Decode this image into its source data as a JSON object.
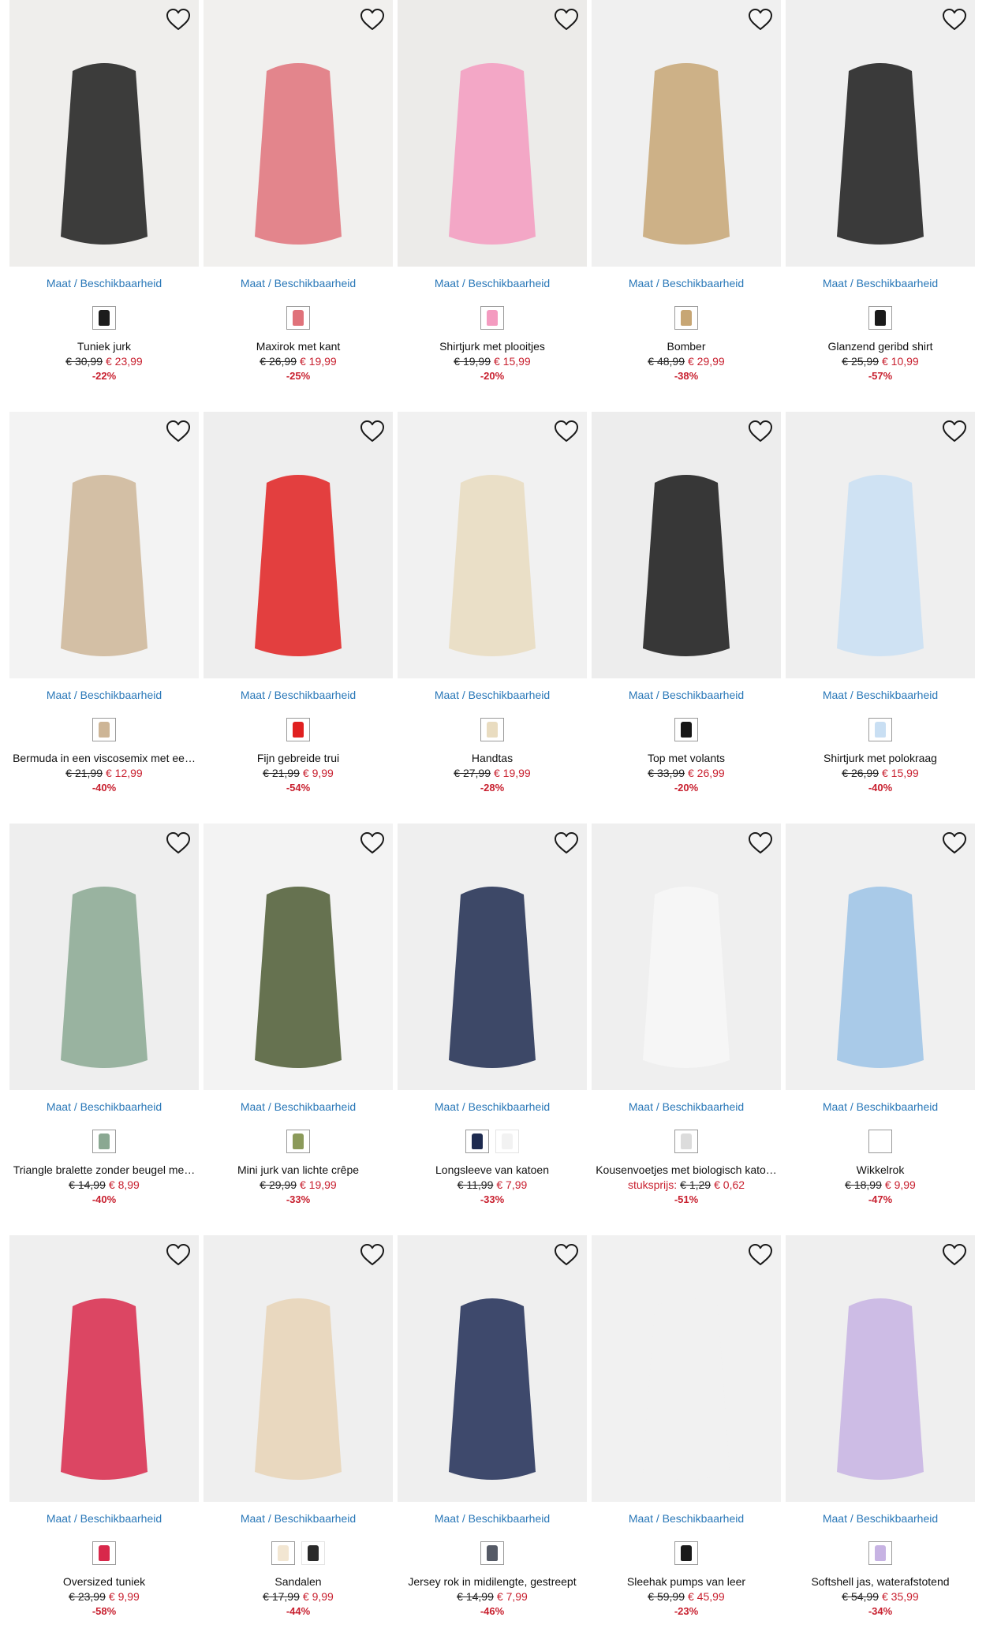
{
  "maat_label": "Maat / Beschikbaarheid",
  "icons": {
    "wishlist": "heart-outline-icon"
  },
  "colors": {
    "link": "#2a78b8",
    "sale": "#c8202f",
    "image_bg": "#efefef"
  },
  "products": [
    {
      "name": "Tuniek jurk",
      "old": "€ 30,99",
      "new": "€ 23,99",
      "disc": "-22%",
      "bg": "#efeeec",
      "fig": "#1c1c1c",
      "sw": [
        "#1c1c1c"
      ]
    },
    {
      "name": "Maxirok met kant",
      "old": "€ 26,99",
      "new": "€ 19,99",
      "disc": "-25%",
      "bg": "#f1f0ee",
      "fig": "#e0727a",
      "sw": [
        "#e0727a"
      ]
    },
    {
      "name": "Shirtjurk met plooitjes",
      "old": "€ 19,99",
      "new": "€ 15,99",
      "disc": "-20%",
      "bg": "#ecebe9",
      "fig": "#f49bc0",
      "sw": [
        "#f49bc0"
      ]
    },
    {
      "name": "Bomber",
      "old": "€ 48,99",
      "new": "€ 29,99",
      "disc": "-38%",
      "bg": "#f0f0f0",
      "fig": "#c7a674",
      "sw": [
        "#c7a674"
      ]
    },
    {
      "name": "Glanzend geribd shirt",
      "old": "€ 25,99",
      "new": "€ 10,99",
      "disc": "-57%",
      "bg": "#efefef",
      "fig": "#1a1a1a",
      "sw": [
        "#1a1a1a"
      ]
    },
    {
      "name": "Bermuda in een viscosemix met ee…",
      "old": "€ 21,99",
      "new": "€ 12,99",
      "disc": "-40%",
      "bg": "#f3f3f3",
      "fig": "#cdb596",
      "sw": [
        "#cdb596"
      ]
    },
    {
      "name": "Fijn gebreide trui",
      "old": "€ 21,99",
      "new": "€ 9,99",
      "disc": "-54%",
      "bg": "#eeeeee",
      "fig": "#e02020",
      "sw": [
        "#e02020"
      ]
    },
    {
      "name": "Handtas",
      "old": "€ 27,99",
      "new": "€ 19,99",
      "disc": "-28%",
      "bg": "#f1f1f1",
      "fig": "#e9dcc0",
      "sw": [
        "#e9dcc0"
      ]
    },
    {
      "name": "Top met volants",
      "old": "€ 33,99",
      "new": "€ 26,99",
      "disc": "-20%",
      "bg": "#ededed",
      "fig": "#161616",
      "sw": [
        "#161616"
      ]
    },
    {
      "name": "Shirtjurk met polokraag",
      "old": "€ 26,99",
      "new": "€ 15,99",
      "disc": "-40%",
      "bg": "#efefef",
      "fig": "#c9dff3",
      "sw": [
        "#c9dff3"
      ]
    },
    {
      "name": "Triangle bralette zonder beugel me…",
      "old": "€ 14,99",
      "new": "€ 8,99",
      "disc": "-40%",
      "bg": "#eeeeee",
      "fig": "#8aa892",
      "sw": [
        "#8aa892"
      ]
    },
    {
      "name": "Mini jurk van lichte crêpe",
      "old": "€ 29,99",
      "new": "€ 19,99",
      "disc": "-33%",
      "bg": "#f3f3f3",
      "fig": "#4c5a32",
      "sw": [
        "#8b9a5a"
      ]
    },
    {
      "name": "Longsleeve van katoen",
      "old": "€ 11,99",
      "new": "€ 7,99",
      "disc": "-33%",
      "bg": "#efefef",
      "fig": "#1d2a4f",
      "sw": [
        "#1d2a4f",
        "#f2f2f2"
      ]
    },
    {
      "name": "Kousenvoetjes met biologisch kato…",
      "pre": "stuksprijs:",
      "old": "€ 1,29",
      "new": "€ 0,62",
      "disc": "-51%",
      "bg": "#efefef",
      "fig": "#f7f7f7",
      "sw": [
        "#dcdcdc"
      ]
    },
    {
      "name": "Wikkelrok",
      "old": "€ 18,99",
      "new": "€ 9,99",
      "disc": "-47%",
      "bg": "#f0f0f0",
      "fig": "#9cc3e6",
      "sw": [
        "#ffffff"
      ]
    },
    {
      "name": "Oversized tuniek",
      "old": "€ 23,99",
      "new": "€ 9,99",
      "disc": "-58%",
      "bg": "#efefef",
      "fig": "#d8284a",
      "sw": [
        "#d8284a"
      ]
    },
    {
      "name": "Sandalen",
      "old": "€ 17,99",
      "new": "€ 9,99",
      "disc": "-44%",
      "bg": "#efefef",
      "fig": "#e8d3b6",
      "sw": [
        "#f2e6d2",
        "#2a2a2a"
      ]
    },
    {
      "name": "Jersey rok in midilengte, gestreept",
      "old": "€ 14,99",
      "new": "€ 7,99",
      "disc": "-46%",
      "bg": "#efefef",
      "fig": "#1e2b55",
      "sw": [
        "#555a66"
      ]
    },
    {
      "name": "Sleehak pumps van leer",
      "old": "€ 59,99",
      "new": "€ 45,99",
      "disc": "-23%",
      "bg": "#f1f1f1",
      "fig": "#f1f1f1",
      "sw": [
        "#1a1a1a"
      ]
    },
    {
      "name": "Softshell jas, waterafstotend",
      "old": "€ 54,99",
      "new": "€ 35,99",
      "disc": "-34%",
      "bg": "#efefef",
      "fig": "#c7b3e3",
      "sw": [
        "#c7b3e3"
      ]
    }
  ]
}
